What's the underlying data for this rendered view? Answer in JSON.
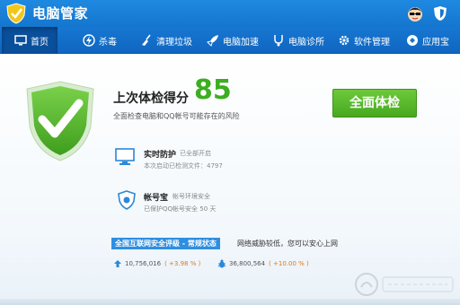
{
  "app": {
    "title": "电脑管家",
    "logo_icon": "qq-shield-icon",
    "avatar_icon": "avatar-icon",
    "shield_icon": "shield-icon"
  },
  "nav": {
    "items": [
      {
        "label": "首页",
        "icon": "monitor-icon",
        "active": true
      },
      {
        "label": "杀毒",
        "icon": "lightning-icon"
      },
      {
        "label": "清理垃圾",
        "icon": "broom-icon"
      },
      {
        "label": "电脑加速",
        "icon": "rocket-icon"
      },
      {
        "label": "电脑诊所",
        "icon": "stethoscope-icon"
      },
      {
        "label": "软件管理",
        "icon": "gear-icon"
      },
      {
        "label": "应用宝",
        "icon": "app-store-icon"
      }
    ]
  },
  "checkup": {
    "last_label": "上次体检得分",
    "score": "85",
    "description": "全面检查电脑和QQ帐号可能存在的风险",
    "button_label": "全面体检"
  },
  "realtime": {
    "title": "实时防护",
    "status": "已全部开启",
    "detail": "本次启动已检测文件：4797"
  },
  "account": {
    "title": "帐号宝",
    "status": "帐号环境安全",
    "detail": "已保护QQ帐号安全 50 天"
  },
  "safety": {
    "badge": "全国互联网安全评级 - 常规状态",
    "text": "网络威胁较低，您可以安心上网"
  },
  "stats": [
    {
      "icon": "arrow-up-icon",
      "value": "10,756,016",
      "change": "( +3.98 % )"
    },
    {
      "icon": "bug-icon",
      "value": "36,800,564",
      "change": "( +10.00 % )"
    }
  ],
  "colors": {
    "header": "#1476cf",
    "score": "#3cae1f",
    "button": "#47a81f",
    "badge": "#2f8ee0",
    "percent": "#e07a10"
  }
}
